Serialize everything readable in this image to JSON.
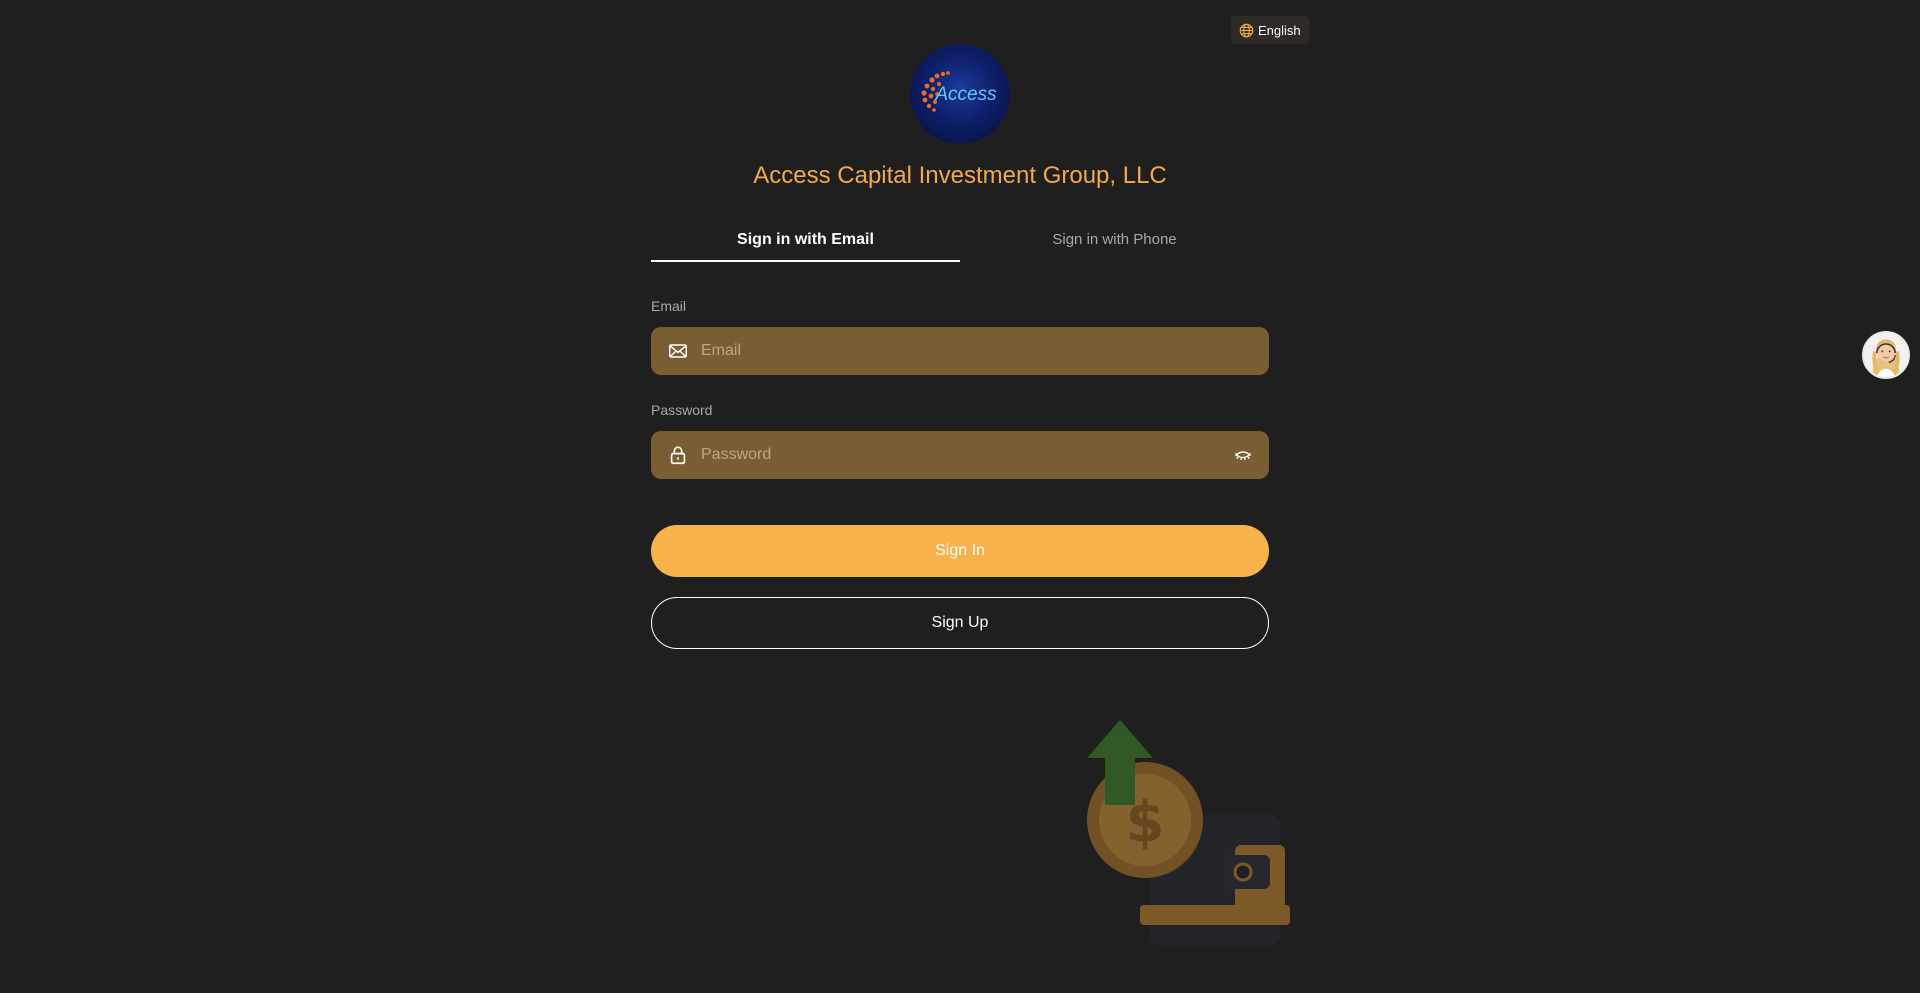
{
  "language": {
    "label": "English",
    "icon": "globe-icon"
  },
  "brand": {
    "logo_text": "Access",
    "company_name": "Access Capital Investment Group, LLC"
  },
  "tabs": [
    {
      "label": "Sign in with Email",
      "active": true
    },
    {
      "label": "Sign in with Phone",
      "active": false
    }
  ],
  "form": {
    "email": {
      "label": "Email",
      "placeholder": "Email",
      "value": "",
      "icon": "mail-icon"
    },
    "password": {
      "label": "Password",
      "placeholder": "Password",
      "value": "",
      "icon": "lock-icon",
      "toggle_icon": "eye-closed-icon"
    }
  },
  "buttons": {
    "sign_in": "Sign In",
    "sign_up": "Sign Up"
  },
  "colors": {
    "background": "#1f1f1f",
    "accent": "#f8b24c",
    "field_bg": "#7a5e33",
    "company_name": "#f2a94b"
  }
}
